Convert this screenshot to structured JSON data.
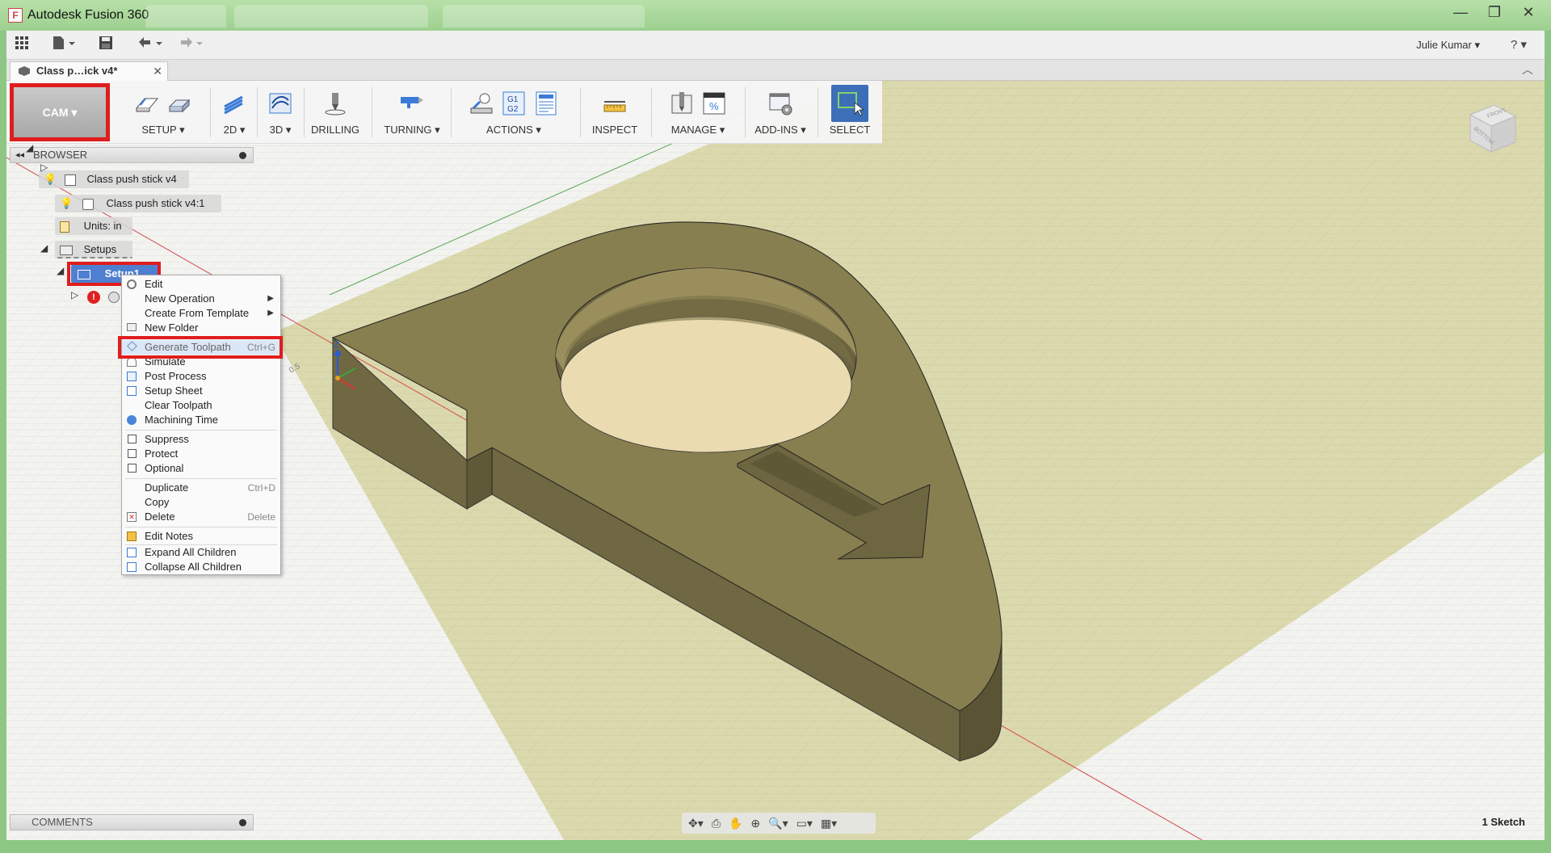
{
  "window": {
    "title": "Autodesk Fusion 360",
    "minimize": "—",
    "maximize": "❐",
    "close": "✕"
  },
  "qat": {
    "user": "Julie Kumar ▾",
    "help": "? ▾"
  },
  "document": {
    "tab_title": "Class p…ick v4*",
    "close": "✕"
  },
  "ribbon": {
    "workspace": "CAM ▾",
    "groups": [
      {
        "label": "SETUP ▾"
      },
      {
        "label": "2D ▾"
      },
      {
        "label": "3D ▾"
      },
      {
        "label": "DRILLING"
      },
      {
        "label": "TURNING ▾"
      },
      {
        "label": "ACTIONS ▾"
      },
      {
        "label": "INSPECT"
      },
      {
        "label": "MANAGE ▾"
      },
      {
        "label": "ADD-INS ▾"
      },
      {
        "label": "SELECT"
      }
    ],
    "actions_g1g2": "G1\nG2",
    "manage_percent": "%"
  },
  "browser": {
    "header": "BROWSER",
    "nodes": {
      "root": "Class push stick v4",
      "component": "Class push stick v4:1",
      "units": "Units: in",
      "setups": "Setups",
      "setup1": "Setup1"
    }
  },
  "context_menu": {
    "items": {
      "edit": "Edit",
      "new_operation": "New Operation",
      "create_from_template": "Create From Template",
      "new_folder": "New Folder",
      "generate_toolpath": "Generate Toolpath",
      "generate_toolpath_shortcut": "Ctrl+G",
      "simulate": "Simulate",
      "post_process": "Post Process",
      "setup_sheet": "Setup Sheet",
      "clear_toolpath": "Clear Toolpath",
      "machining_time": "Machining Time",
      "suppress": "Suppress",
      "protect": "Protect",
      "optional": "Optional",
      "duplicate": "Duplicate",
      "duplicate_shortcut": "Ctrl+D",
      "copy": "Copy",
      "delete": "Delete",
      "delete_shortcut": "Delete",
      "edit_notes": "Edit Notes",
      "expand_all": "Expand All Children",
      "collapse_all": "Collapse All Children"
    }
  },
  "viewport": {
    "axis_z": "Z",
    "grid_label": "0.5",
    "view_cube": {
      "front": "FRONT",
      "bottom": "BOTTOM"
    },
    "sketch_count": "1 Sketch"
  },
  "comments": {
    "label": "COMMENTS"
  },
  "colors": {
    "accent_red": "#e01d1d",
    "body_olive": "#7d7446",
    "body_face": "#8e8656",
    "hole_floor": "#eadbb0",
    "sketch_plane": "#d6d4a2",
    "titlebar_green": "#9dd08f"
  }
}
